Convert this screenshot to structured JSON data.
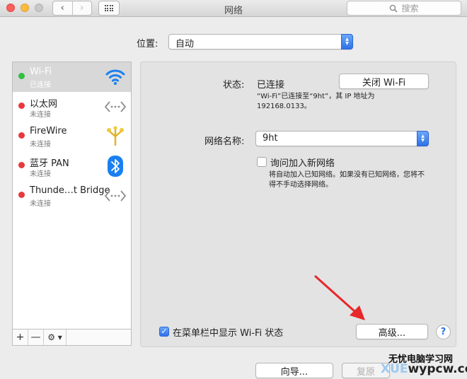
{
  "window": {
    "title": "网络",
    "nav_back": "‹",
    "nav_forward": "›",
    "search_placeholder": "搜索"
  },
  "location": {
    "label": "位置:",
    "value": "自动"
  },
  "services": [
    {
      "name": "Wi-Fi",
      "status": "已连接",
      "indicator": "#2fc13f",
      "icon": "wifi-icon",
      "selected": true
    },
    {
      "name": "以太网",
      "status": "未连接",
      "indicator": "#e8383d",
      "icon": "ethernet-icon"
    },
    {
      "name": "FireWire",
      "status": "未连接",
      "indicator": "#e8383d",
      "icon": "firewire-icon"
    },
    {
      "name": "蓝牙 PAN",
      "status": "未连接",
      "indicator": "#e8383d",
      "icon": "bluetooth-icon"
    },
    {
      "name": "Thunde…t Bridge",
      "status": "未连接",
      "indicator": "#e8383d",
      "icon": "ethernet-icon"
    }
  ],
  "sidebar_controls": {
    "add": "+",
    "remove": "—",
    "gear": "⚙︎ ▾"
  },
  "wifi_panel": {
    "status_label": "状态:",
    "status_value": "已连接",
    "toggle_button": "关闭 Wi-Fi",
    "status_detail_line1": "“Wi-Fi”已连接至“9ht”，其 IP 地址为",
    "status_detail_line2": "192168.0133。",
    "network_name_label": "网络名称:",
    "network_name_value": "9ht",
    "ask_join_label": "询问加入新网络",
    "ask_join_checked": false,
    "ask_join_desc_line1": "将自动加入已知网络。如果没有已知网络，您将不",
    "ask_join_desc_line2": "得不手动选择网络。",
    "show_menubar_label": "在菜单栏中显示 Wi-Fi 状态",
    "show_menubar_checked": true,
    "advanced_button": "高级...",
    "help_button": "?"
  },
  "footer": {
    "assist_button": "向导...",
    "revert_button": "复原"
  },
  "watermark": {
    "line1": "无忧电脑学习网",
    "line2_prefix": "XUE",
    "line2_main": "wypcw.com"
  },
  "colors": {
    "accent": "#2f72e8",
    "connected": "#2fc13f",
    "disconnected": "#e8383d",
    "arrow": "#e8272a"
  }
}
